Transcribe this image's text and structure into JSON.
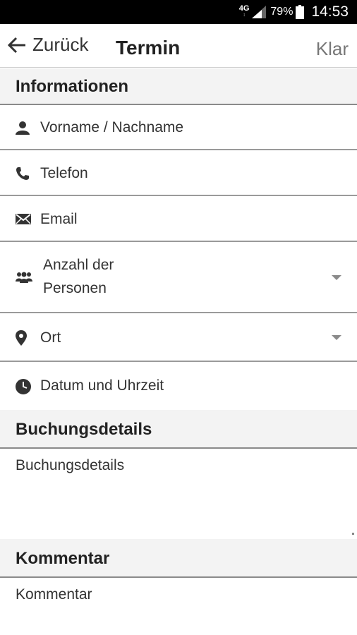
{
  "status_bar": {
    "network": "4G",
    "network_sub": "↕",
    "battery": "79%",
    "time": "14:53",
    "icons": [
      "signal-icon",
      "battery-icon"
    ]
  },
  "app_bar": {
    "back_label": "Zurück",
    "title": "Termin",
    "done_label": "Klar",
    "back_icon": "arrow-left-icon"
  },
  "sections": {
    "informationen": "Informationen",
    "buchungsdetails": "Buchungsdetails",
    "kommentar": "Kommentar"
  },
  "fields": {
    "name": {
      "placeholder": "Vorname / Nachname",
      "icon": "person-icon"
    },
    "phone": {
      "placeholder": "Telefon",
      "icon": "phone-icon"
    },
    "email": {
      "placeholder": "Email",
      "icon": "envelope-icon"
    },
    "persons": {
      "placeholder_line1": "Anzahl der",
      "placeholder_line2": "Personen",
      "icon": "group-icon"
    },
    "location": {
      "placeholder": "Ort",
      "icon": "location-pin-icon"
    },
    "datetime": {
      "placeholder": "Datum und Uhrzeit",
      "icon": "clock-icon"
    },
    "booking_details": {
      "placeholder": "Buchungsdetails"
    },
    "comment": {
      "placeholder": "Kommentar"
    }
  }
}
